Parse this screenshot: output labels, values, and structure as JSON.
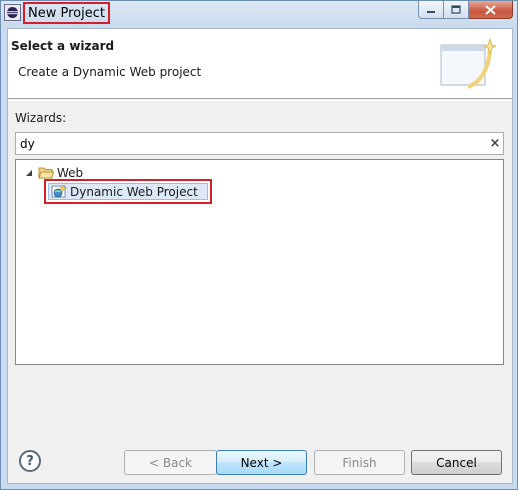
{
  "window": {
    "title": "New Project",
    "controls": {
      "minimize": "minimize",
      "maximize": "maximize",
      "close": "close"
    }
  },
  "banner": {
    "title": "Select a wizard",
    "description": "Create a Dynamic Web project",
    "graphic_icon": "wizard-banner-graphic"
  },
  "wizards": {
    "label": "Wizards:",
    "filter_value": "dy",
    "clear_icon": "×",
    "tree": [
      {
        "label": "Web",
        "expanded": true,
        "icon": "folder-open-icon",
        "children": [
          {
            "label": "Dynamic Web Project",
            "selected": true,
            "icon": "dynamic-web-project-icon"
          }
        ]
      }
    ]
  },
  "buttons": {
    "help": "?",
    "back": "< Back",
    "next": "Next >",
    "finish": "Finish",
    "cancel": "Cancel"
  },
  "states": {
    "back_enabled": false,
    "next_enabled": true,
    "finish_enabled": false,
    "cancel_enabled": true
  },
  "colors": {
    "highlight_border": "#d21f2a",
    "selection_bg": "#dde9f7",
    "banner_bg": "#ffffff",
    "dialog_bg": "#f0f0f0"
  }
}
